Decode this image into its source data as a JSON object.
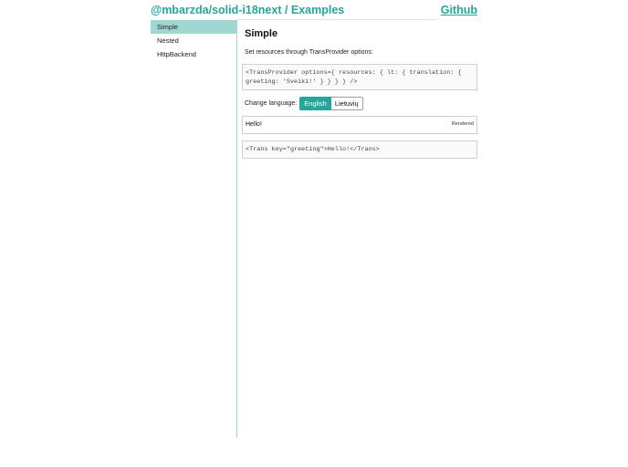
{
  "header": {
    "title": "@mbarzda/solid-i18next / Examples",
    "github_label": "Github"
  },
  "sidebar": {
    "items": [
      {
        "label": "Simple",
        "active": true
      },
      {
        "label": "Nested",
        "active": false
      },
      {
        "label": "HttpBackend",
        "active": false
      }
    ]
  },
  "main": {
    "title": "Simple",
    "description": "Set resources through TransProvider options:",
    "provider_code_line1": "<TransProvider options={ resources: { lt: { translation: {",
    "provider_code_line2": "greeting: 'Sveiki!' } } } } />",
    "language": {
      "label": "Change language:",
      "options": [
        "English",
        "Lietuvių"
      ],
      "selected": "English"
    },
    "rendered": {
      "text": "Hello!",
      "badge": "Rendered"
    },
    "trans_code": "<Trans key=\"greeting\">Hello!</Trans>"
  },
  "colors": {
    "accent": "#26a69a",
    "sidebar_active": "#9fd8d2"
  }
}
